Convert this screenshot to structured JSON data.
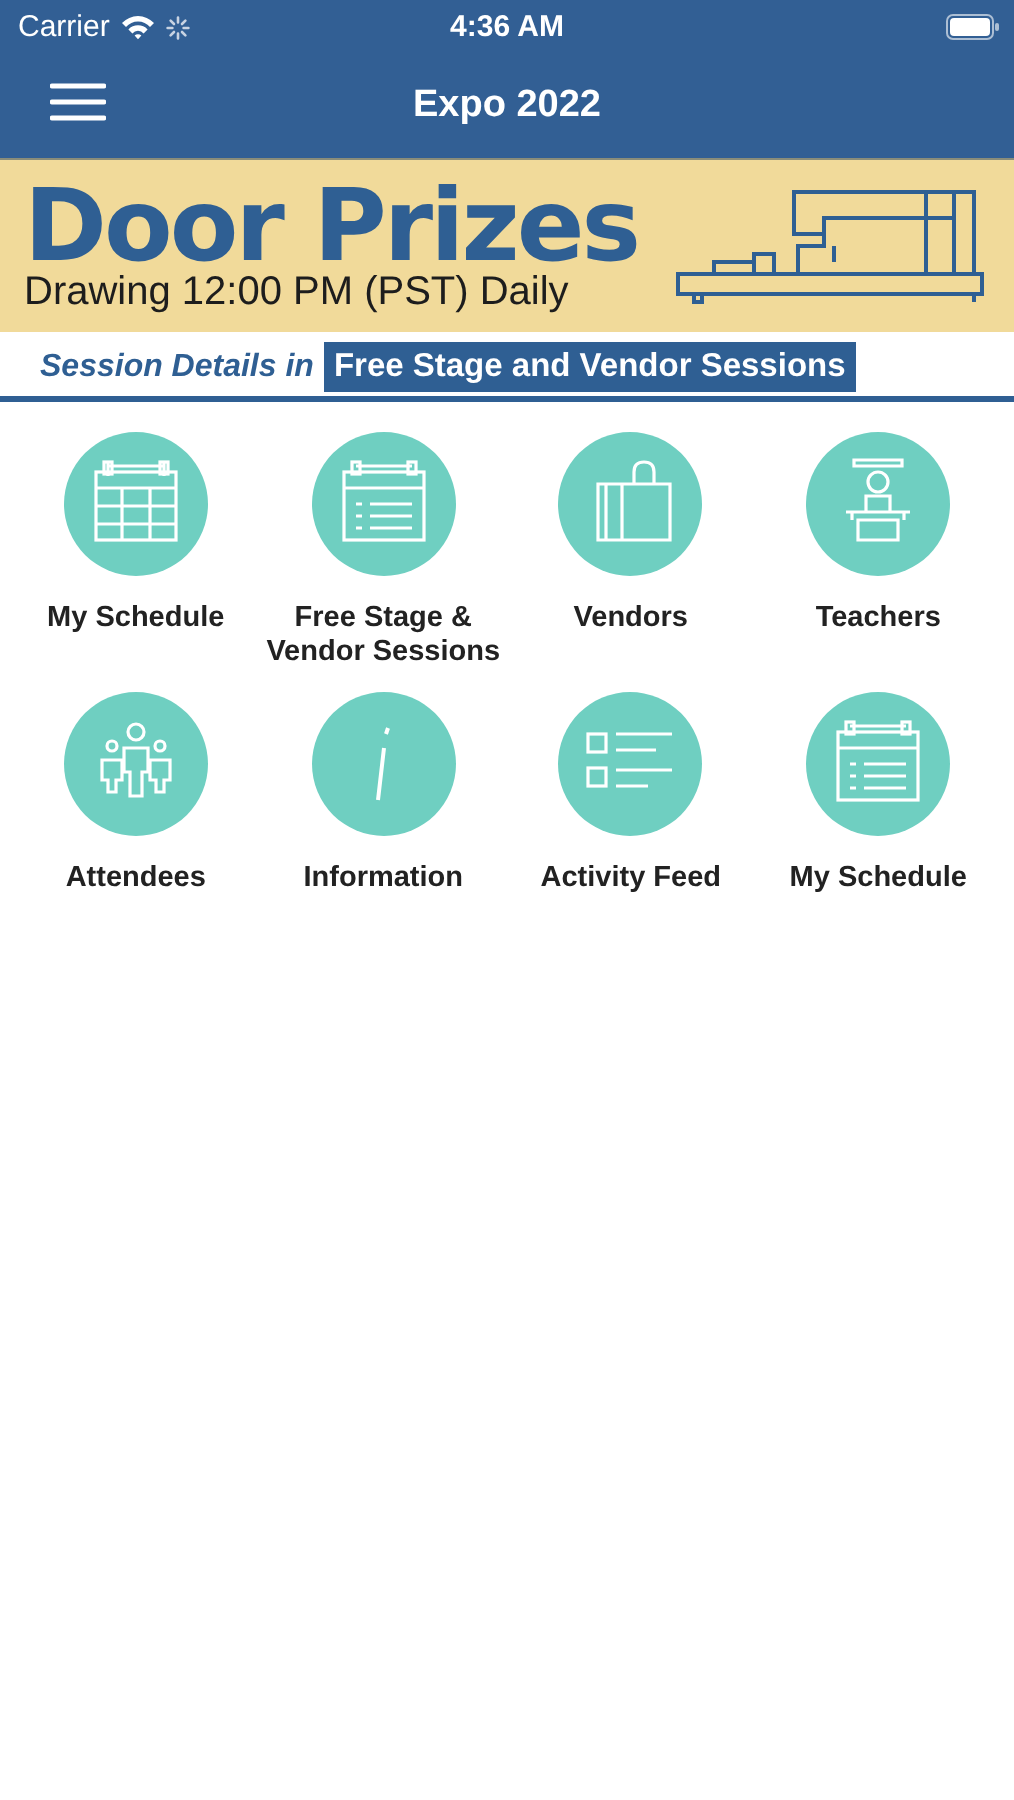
{
  "status_bar": {
    "carrier": "Carrier",
    "time": "4:36 AM"
  },
  "nav_bar": {
    "title": "Expo 2022"
  },
  "banner": {
    "headline": "Door Prizes",
    "subline": "Drawing 12:00 PM (PST) Daily",
    "lead_text": "Session Details in",
    "link_text": "Free Stage and Vendor Sessions"
  },
  "tiles": [
    {
      "kind": "calendar-grid",
      "label": "My Schedule"
    },
    {
      "kind": "calendar-list",
      "label": "Free Stage & Vendor Sessions"
    },
    {
      "kind": "bag",
      "label": "Vendors"
    },
    {
      "kind": "teacher",
      "label": "Teachers"
    },
    {
      "kind": "people",
      "label": "Attendees"
    },
    {
      "kind": "info",
      "label": "Information"
    },
    {
      "kind": "checklist",
      "label": "Activity Feed"
    },
    {
      "kind": "calendar-list",
      "label": "My Schedule"
    }
  ]
}
